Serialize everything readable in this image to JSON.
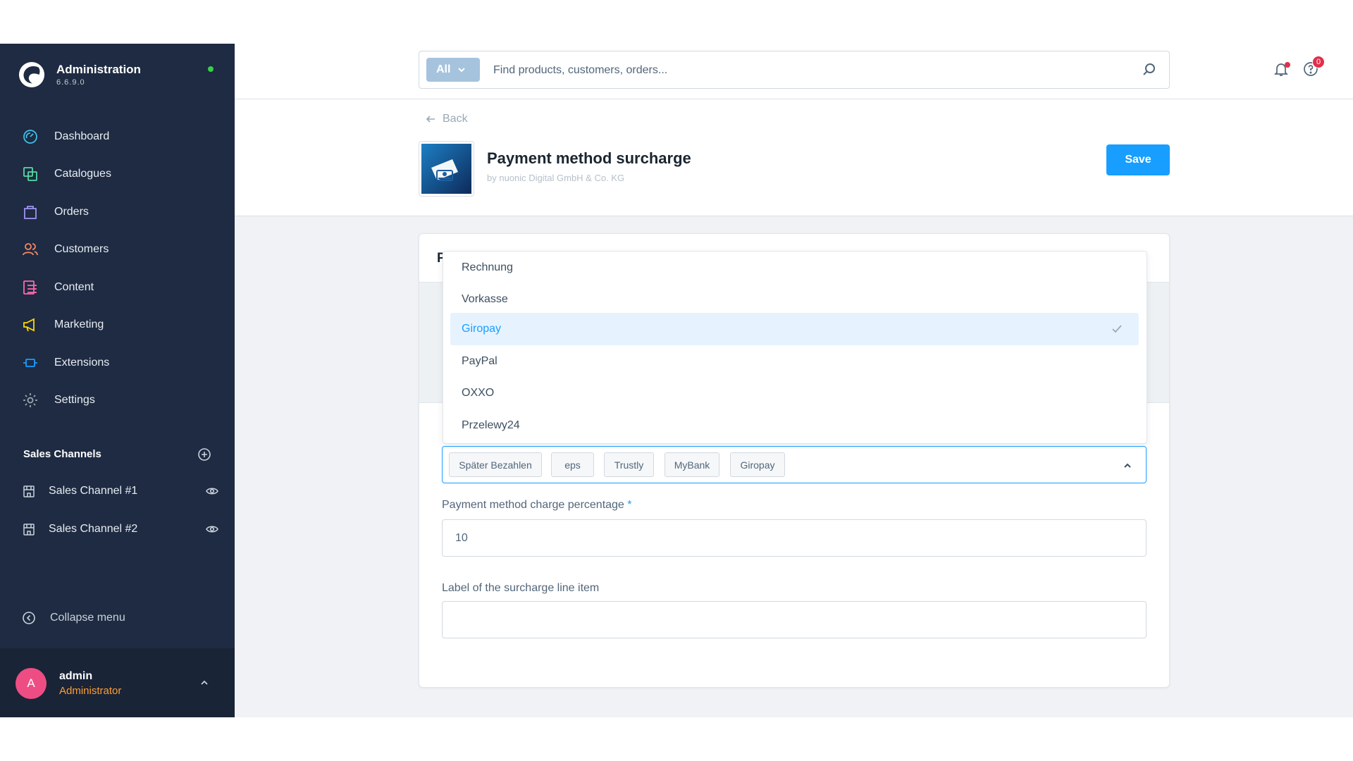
{
  "app": {
    "title": "Administration",
    "version": "6.6.9.0"
  },
  "nav": [
    {
      "label": "Dashboard",
      "icon": "dashboard-icon",
      "color": "#3fc0e8"
    },
    {
      "label": "Catalogues",
      "icon": "catalogue-icon",
      "color": "#57d9a3"
    },
    {
      "label": "Orders",
      "icon": "orders-icon",
      "color": "#a092f0"
    },
    {
      "label": "Customers",
      "icon": "customers-icon",
      "color": "#f88962"
    },
    {
      "label": "Content",
      "icon": "content-icon",
      "color": "#ff68ac"
    },
    {
      "label": "Marketing",
      "icon": "marketing-icon",
      "color": "#ffd700"
    },
    {
      "label": "Extensions",
      "icon": "extensions-icon",
      "color": "#189eff"
    },
    {
      "label": "Settings",
      "icon": "settings-icon",
      "color": "#9aa8b5"
    }
  ],
  "sales_channels": {
    "title": "Sales Channels",
    "items": [
      {
        "label": "Sales Channel #1"
      },
      {
        "label": "Sales Channel #2"
      }
    ]
  },
  "collapse_label": "Collapse menu",
  "user": {
    "initial": "A",
    "name": "admin",
    "role": "Administrator"
  },
  "search": {
    "type_label": "All",
    "placeholder": "Find products, customers, orders..."
  },
  "notifications": {
    "help_count": "0"
  },
  "page": {
    "back_label": "Back",
    "title": "Payment method surcharge",
    "subtitle": "by nuonic Digital GmbH & Co. KG",
    "save_label": "Save",
    "card_title_partial": "P"
  },
  "dropdown": {
    "options": [
      {
        "label": "Rechnung",
        "selected": false
      },
      {
        "label": "Vorkasse",
        "selected": false
      },
      {
        "label": "Giropay",
        "selected": true
      },
      {
        "label": "PayPal",
        "selected": false
      },
      {
        "label": "OXXO",
        "selected": false
      },
      {
        "label": "Przelewy24",
        "selected": false
      }
    ]
  },
  "selected_tags": [
    "Später Bezahlen",
    "eps",
    "Trustly",
    "MyBank",
    "Giropay"
  ],
  "fields": {
    "percentage_label": "Payment method charge percentage",
    "percentage_required_mark": "*",
    "percentage_value": "10",
    "line_item_label": "Label of the surcharge line item",
    "line_item_value": ""
  },
  "colors": {
    "primary": "#189eff",
    "sidebar": "#1e2b42",
    "danger": "#e12f4b",
    "online": "#37d046"
  }
}
